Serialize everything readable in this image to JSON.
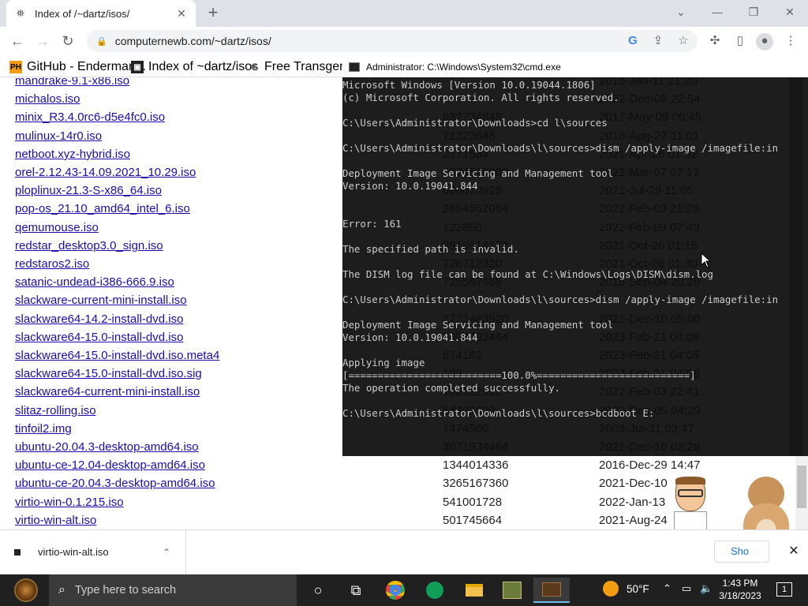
{
  "browser": {
    "tab_title": "Index of /~dartz/isos/",
    "url": "computernewb.com/~dartz/isos/",
    "bookmarks": [
      "GitHub - Enderman...",
      "Index of ~dartz/isos",
      "Free Transgender"
    ]
  },
  "listing": [
    {
      "name": "mandrake-9.1-x86.iso",
      "size": "",
      "date": "2016-Jan-11 21:20"
    },
    {
      "name": "michalos.iso",
      "size": "",
      "date": "2022-Dec-08 22:54"
    },
    {
      "name": "minix_R3.4.0rc6-d5e4fc0.iso",
      "size": "632734848",
      "date": "2017-May-09 06:45"
    },
    {
      "name": "mulinux-14r0.iso",
      "size": "71323648",
      "date": "2016-Aug-27 11:01"
    },
    {
      "name": "netboot.xyz-hybrid.iso",
      "size": "2371584",
      "date": "2021-Apr-26 01:32"
    },
    {
      "name": "orel-2.12.43-14.09.2021_10.29.iso",
      "size": "4374528000",
      "date": "2022-Mar-07 07:13"
    },
    {
      "name": "ploplinux-21.3-S-x86_64.iso",
      "size": "660070928",
      "date": "2021-Jul-29 11:05"
    },
    {
      "name": "pop-os_21.10_amd64_intel_6.iso",
      "size": "2654552064",
      "date": "2022-Feb-03 21:28"
    },
    {
      "name": "qemumouse.iso",
      "size": "122880",
      "date": "2022-Feb-09 07:49"
    },
    {
      "name": "redstar_desktop3.0_sign.iso",
      "size": "3818614272",
      "date": "2021-Oct-26 01:15"
    },
    {
      "name": "redstaros2.iso",
      "size": "726712320",
      "date": "2021-Oct-26 01:30"
    },
    {
      "name": "satanic-undead-i386-666.9.iso",
      "size": "725567488",
      "date": "2015-Sep-04 20:29"
    },
    {
      "name": "slackware-current-mini-install.iso",
      "size": "",
      "date": ""
    },
    {
      "name": "slackware64-14.2-install-dvd.iso",
      "size": "2773483520",
      "date": "2021-Dec-10 05:00"
    },
    {
      "name": "slackware64-15.0-install-dvd.iso",
      "size": "3893792464",
      "date": "2023-Feb-21 04:08"
    },
    {
      "name": "slackware64-15.0-install-dvd.iso.meta4",
      "size": "874162",
      "date": "2023-Feb-21 04:05"
    },
    {
      "name": "slackware64-15.0-install-dvd.iso.sig",
      "size": "198",
      "date": "2023-Feb-21 04:08"
    },
    {
      "name": "slackware64-current-mini-install.iso",
      "size": "102182912",
      "date": "2022-Feb-03 22:41"
    },
    {
      "name": "slitaz-rolling.iso",
      "size": "54400000",
      "date": "2022-Dec-05 04:29"
    },
    {
      "name": "tinfoil2.img",
      "size": "1474560",
      "date": "2003-Jul-31 03:47"
    },
    {
      "name": "ubuntu-20.04.3-desktop-amd64.iso",
      "size": "3071934464",
      "date": "2021-Dec-10 02:28"
    },
    {
      "name": "ubuntu-ce-12.04-desktop-amd64.iso",
      "size": "1344014336",
      "date": "2016-Dec-29 14:47"
    },
    {
      "name": "ubuntu-ce-20.04.3-desktop-amd64.iso",
      "size": "3265167360",
      "date": "2021-Dec-10"
    },
    {
      "name": "virtio-win-0.1.215.iso",
      "size": "541001728",
      "date": "2022-Jan-13"
    },
    {
      "name": "virtio-win-alt.iso",
      "size": "501745664",
      "date": "2021-Aug-24"
    }
  ],
  "cmd": {
    "title": "Administrator: C:\\Windows\\System32\\cmd.exe",
    "lines": [
      "Microsoft Windows [Version 10.0.19044.1806]",
      "(c) Microsoft Corporation. All rights reserved.",
      "",
      "C:\\Users\\Administrator\\Downloads>cd l\\sources",
      "",
      "C:\\Users\\Administrator\\Downloads\\l\\sources>dism /apply-image /imagefile:in",
      "",
      "Deployment Image Servicing and Management tool",
      "Version: 10.0.19041.844",
      "",
      "",
      "Error: 161",
      "",
      "The specified path is invalid.",
      "",
      "The DISM log file can be found at C:\\Windows\\Logs\\DISM\\dism.log",
      "",
      "C:\\Users\\Administrator\\Downloads\\l\\sources>dism /apply-image /imagefile:in",
      "",
      "Deployment Image Servicing and Management tool",
      "Version: 10.0.19041.844",
      "",
      "Applying image",
      "[==========================100.0%==========================]",
      "The operation completed successfully.",
      "",
      "C:\\Users\\Administrator\\Downloads\\l\\sources>bcdboot E:"
    ]
  },
  "download": {
    "filename": "virtio-win-alt.iso",
    "show_all": "Sho"
  },
  "taskbar": {
    "search_placeholder": "Type here to search",
    "weather": "50°F",
    "time": "1:43 PM",
    "date": "3/18/2023",
    "notif_count": "1"
  }
}
